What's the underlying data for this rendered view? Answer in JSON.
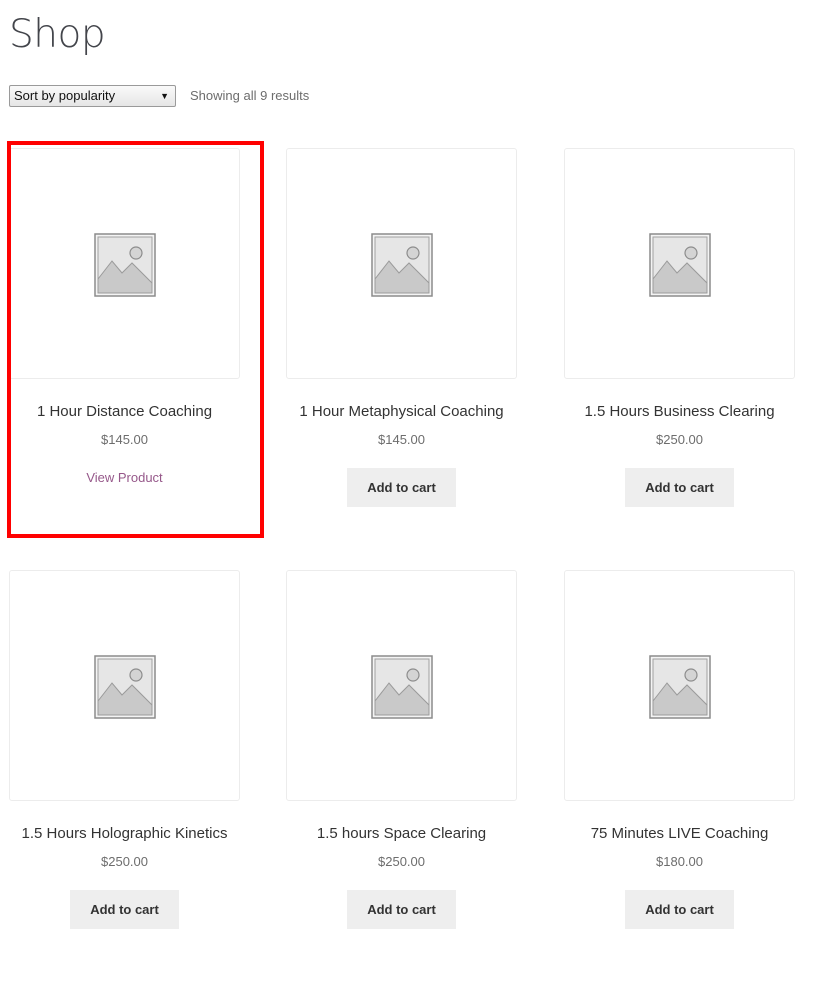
{
  "page": {
    "title": "Shop"
  },
  "toolbar": {
    "sort_selected": "Sort by popularity",
    "result_count": "Showing all 9 results"
  },
  "products": [
    {
      "title": "1 Hour Distance Coaching",
      "price": "$145.00",
      "action_label": "View Product",
      "action_type": "link"
    },
    {
      "title": "1 Hour Metaphysical Coaching",
      "price": "$145.00",
      "action_label": "Add to cart",
      "action_type": "button"
    },
    {
      "title": "1.5 Hours Business Clearing",
      "price": "$250.00",
      "action_label": "Add to cart",
      "action_type": "button"
    },
    {
      "title": "1.5 Hours Holographic Kinetics",
      "price": "$250.00",
      "action_label": "Add to cart",
      "action_type": "button"
    },
    {
      "title": "1.5 hours Space Clearing",
      "price": "$250.00",
      "action_label": "Add to cart",
      "action_type": "button"
    },
    {
      "title": "75 Minutes LIVE Coaching",
      "price": "$180.00",
      "action_label": "Add to cart",
      "action_type": "button"
    }
  ],
  "icons": {
    "placeholder": "image-placeholder-icon",
    "sort_caret": "caret-down-icon"
  },
  "colors": {
    "link": "#96588a",
    "button_bg": "#eeeeee",
    "highlight": "#ff0000",
    "card_border": "#ececec"
  }
}
